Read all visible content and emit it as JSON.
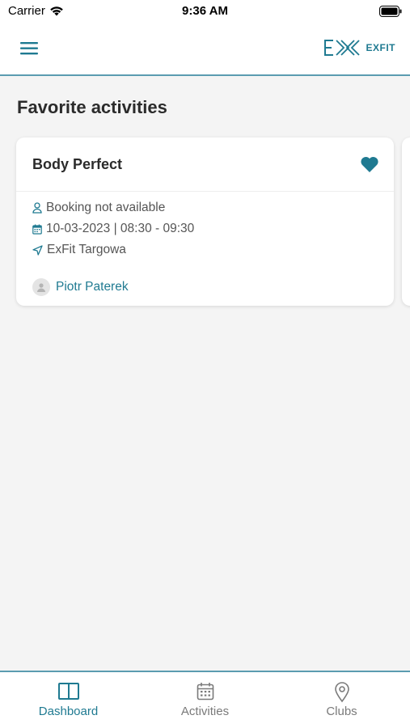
{
  "status_bar": {
    "carrier": "Carrier",
    "time": "9:36 AM"
  },
  "header": {
    "menu_icon": "hamburger-icon",
    "logo_text": "EXFIT"
  },
  "page": {
    "title": "Favorite activities"
  },
  "favorites": [
    {
      "title": "Body Perfect",
      "favorited": true,
      "booking_status": "Booking not available",
      "date_time": "10-03-2023 | 08:30 - 09:30",
      "location": "ExFit Targowa",
      "trainer": "Piotr Paterek"
    }
  ],
  "tabbar": {
    "tabs": [
      {
        "label": "Dashboard",
        "icon": "dashboard-icon",
        "active": true
      },
      {
        "label": "Activities",
        "icon": "calendar-icon",
        "active": false
      },
      {
        "label": "Clubs",
        "icon": "map-pin-icon",
        "active": false
      }
    ]
  },
  "colors": {
    "accent": "#1f7a91",
    "divider": "#5b9cb0",
    "background": "#f4f4f4"
  }
}
